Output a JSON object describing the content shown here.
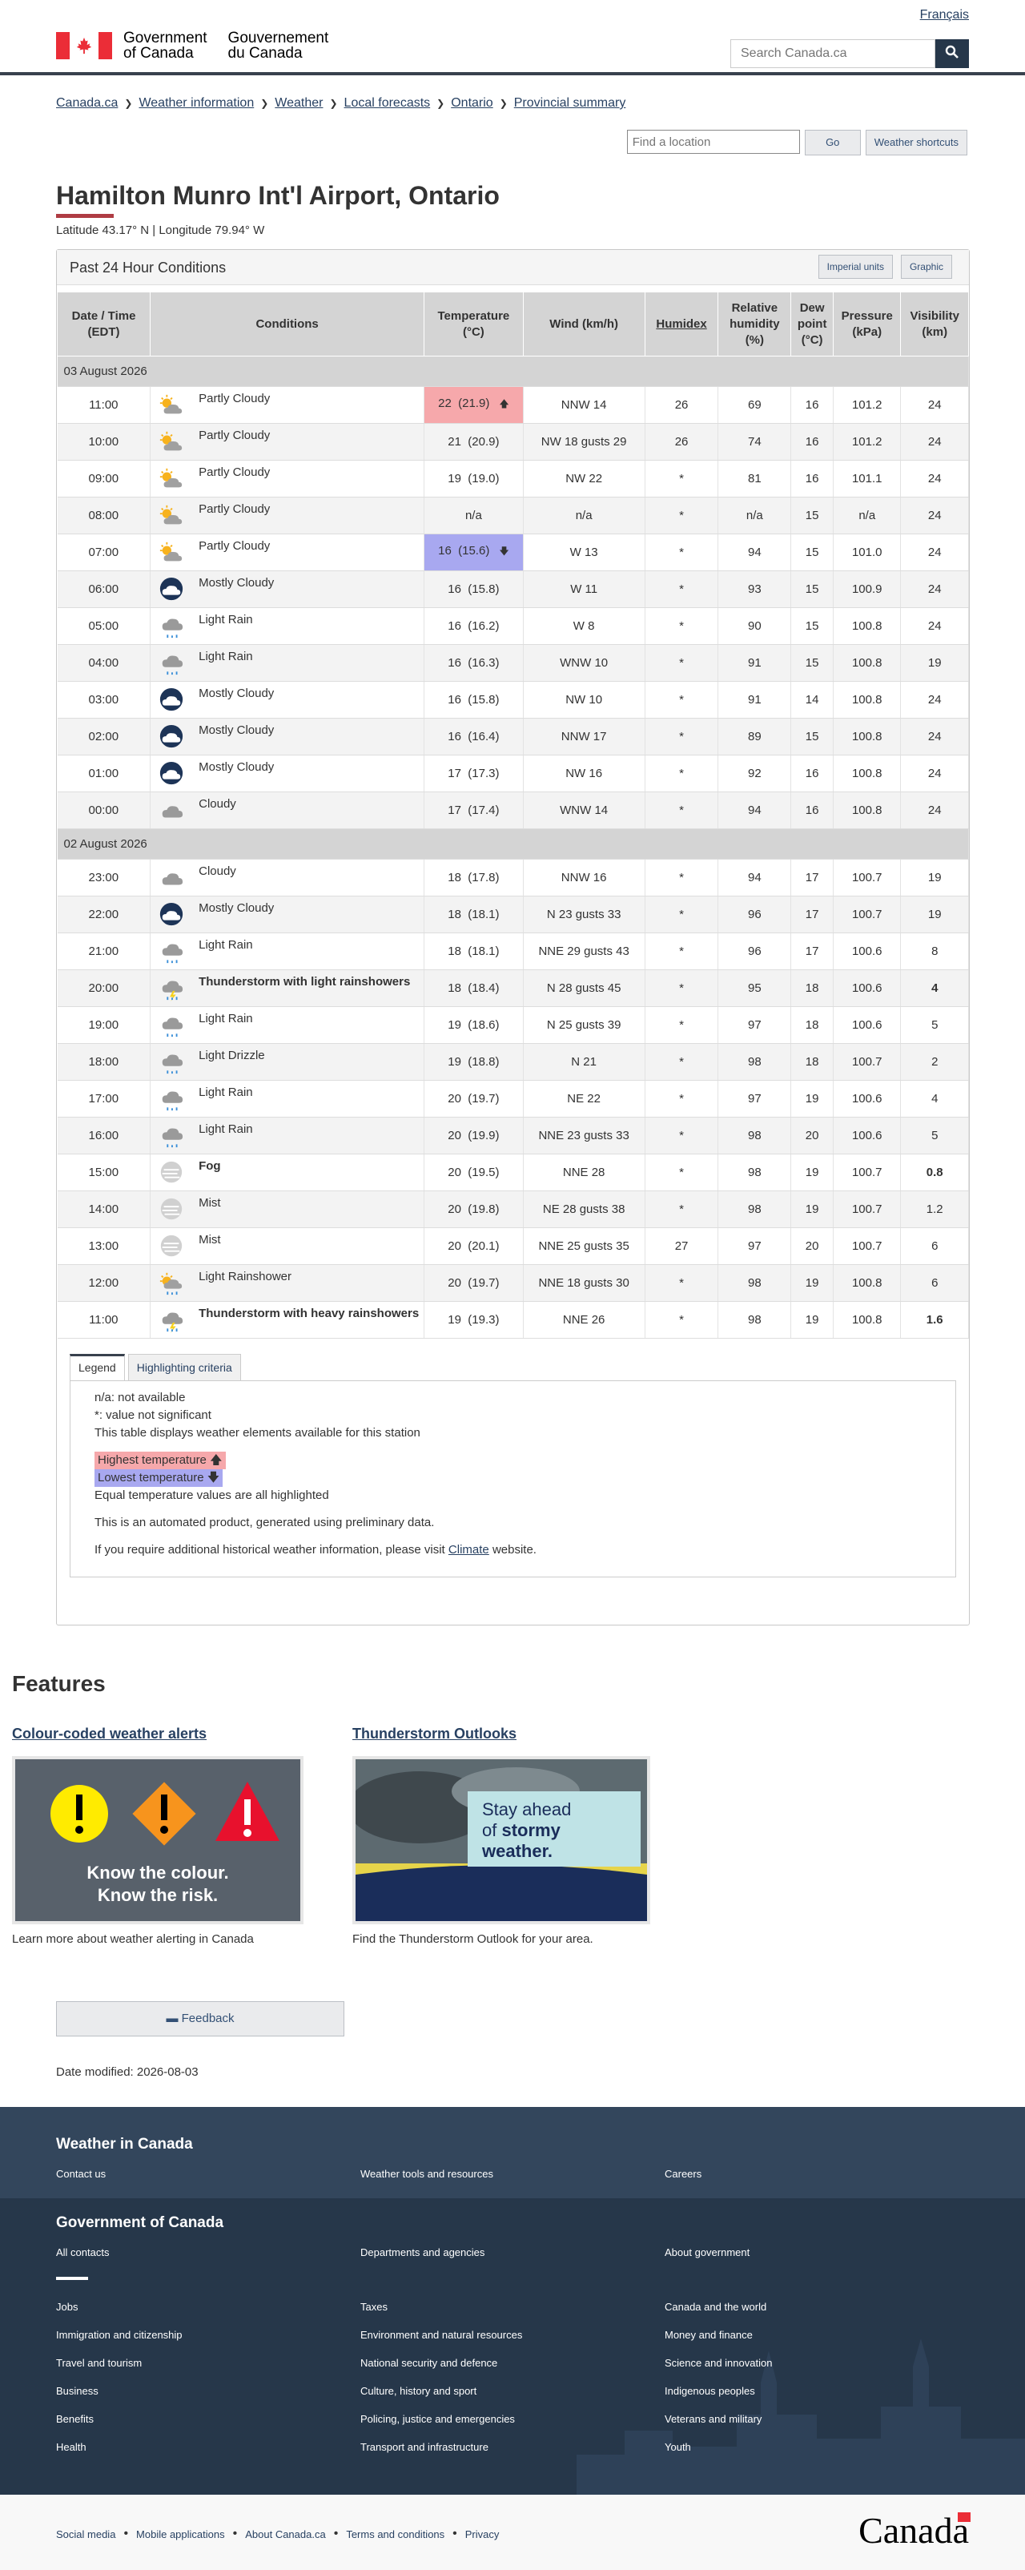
{
  "header": {
    "language_link": "Français",
    "signature_en": [
      "Government",
      "of Canada"
    ],
    "signature_fr": [
      "Gouvernement",
      "du Canada"
    ],
    "search_placeholder": "Search Canada.ca"
  },
  "breadcrumb": [
    "Canada.ca",
    "Weather information",
    "Weather",
    "Local forecasts",
    "Ontario",
    "Provincial summary"
  ],
  "location_search": {
    "placeholder": "Find a location",
    "go_label": "Go",
    "shortcuts_label": "Weather shortcuts"
  },
  "page": {
    "title": "Hamilton Munro Int'l Airport, Ontario",
    "latlon": "Latitude 43.17° N | Longitude 79.94° W"
  },
  "panel": {
    "title": "Past 24 Hour Conditions",
    "imperial_label": "Imperial units",
    "graphic_label": "Graphic",
    "columns": [
      "Date / Time (EDT)",
      "Conditions",
      "Temperature (°C)",
      "Wind (km/h)",
      "Humidex",
      "Relative humidity (%)",
      "Dew point (°C)",
      "Pressure (kPa)",
      "Visibility (km)"
    ],
    "date1": "03 August 2026",
    "date2": "02 August 2026",
    "rows_day1": [
      {
        "time": "11:00",
        "icon": "partly-cloudy",
        "cond": "Partly Cloudy",
        "temp": "22  (21.9)",
        "wind": "NNW 14",
        "humidex": "26",
        "rh": "69",
        "dew": "16",
        "pres": "101.2",
        "vis": "24",
        "flag": "hi"
      },
      {
        "time": "10:00",
        "icon": "partly-cloudy",
        "cond": "Partly Cloudy",
        "temp": "21  (20.9)",
        "wind": "NW 18 gusts 29",
        "humidex": "26",
        "rh": "74",
        "dew": "16",
        "pres": "101.2",
        "vis": "24"
      },
      {
        "time": "09:00",
        "icon": "partly-cloudy",
        "cond": "Partly Cloudy",
        "temp": "19  (19.0)",
        "wind": "NW 22",
        "humidex": "*",
        "rh": "81",
        "dew": "16",
        "pres": "101.1",
        "vis": "24"
      },
      {
        "time": "08:00",
        "icon": "partly-cloudy",
        "cond": "Partly Cloudy",
        "temp": "n/a",
        "wind": "n/a",
        "humidex": "*",
        "rh": "n/a",
        "dew": "15",
        "pres": "n/a",
        "vis": "24"
      },
      {
        "time": "07:00",
        "icon": "partly-cloudy",
        "cond": "Partly Cloudy",
        "temp": "16  (15.6)",
        "wind": "W 13",
        "humidex": "*",
        "rh": "94",
        "dew": "15",
        "pres": "101.0",
        "vis": "24",
        "flag": "lo"
      },
      {
        "time": "06:00",
        "icon": "mostly-cloudy",
        "cond": "Mostly Cloudy",
        "temp": "16  (15.8)",
        "wind": "W 11",
        "humidex": "*",
        "rh": "93",
        "dew": "15",
        "pres": "100.9",
        "vis": "24"
      },
      {
        "time": "05:00",
        "icon": "light-rain",
        "cond": "Light Rain",
        "temp": "16  (16.2)",
        "wind": "W 8",
        "humidex": "*",
        "rh": "90",
        "dew": "15",
        "pres": "100.8",
        "vis": "24"
      },
      {
        "time": "04:00",
        "icon": "light-rain",
        "cond": "Light Rain",
        "temp": "16  (16.3)",
        "wind": "WNW 10",
        "humidex": "*",
        "rh": "91",
        "dew": "15",
        "pres": "100.8",
        "vis": "19"
      },
      {
        "time": "03:00",
        "icon": "mostly-cloudy",
        "cond": "Mostly Cloudy",
        "temp": "16  (15.8)",
        "wind": "NW 10",
        "humidex": "*",
        "rh": "91",
        "dew": "14",
        "pres": "100.8",
        "vis": "24"
      },
      {
        "time": "02:00",
        "icon": "mostly-cloudy",
        "cond": "Mostly Cloudy",
        "temp": "16  (16.4)",
        "wind": "NNW 17",
        "humidex": "*",
        "rh": "89",
        "dew": "15",
        "pres": "100.8",
        "vis": "24"
      },
      {
        "time": "01:00",
        "icon": "mostly-cloudy",
        "cond": "Mostly Cloudy",
        "temp": "17  (17.3)",
        "wind": "NW 16",
        "humidex": "*",
        "rh": "92",
        "dew": "16",
        "pres": "100.8",
        "vis": "24"
      },
      {
        "time": "00:00",
        "icon": "cloudy",
        "cond": "Cloudy",
        "temp": "17  (17.4)",
        "wind": "WNW 14",
        "humidex": "*",
        "rh": "94",
        "dew": "16",
        "pres": "100.8",
        "vis": "24"
      }
    ],
    "rows_day2": [
      {
        "time": "23:00",
        "icon": "cloudy",
        "cond": "Cloudy",
        "temp": "18  (17.8)",
        "wind": "NNW 16",
        "humidex": "*",
        "rh": "94",
        "dew": "17",
        "pres": "100.7",
        "vis": "19"
      },
      {
        "time": "22:00",
        "icon": "mostly-cloudy",
        "cond": "Mostly Cloudy",
        "temp": "18  (18.1)",
        "wind": "N 23 gusts 33",
        "humidex": "*",
        "rh": "96",
        "dew": "17",
        "pres": "100.7",
        "vis": "19"
      },
      {
        "time": "21:00",
        "icon": "light-rain",
        "cond": "Light Rain",
        "temp": "18  (18.1)",
        "wind": "NNE 29 gusts 43",
        "humidex": "*",
        "rh": "96",
        "dew": "17",
        "pres": "100.6",
        "vis": "8"
      },
      {
        "time": "20:00",
        "icon": "thunderstorm",
        "cond": "Thunderstorm with light rainshowers",
        "temp": "18  (18.4)",
        "wind": "N 28 gusts 45",
        "humidex": "*",
        "rh": "95",
        "dew": "18",
        "pres": "100.6",
        "vis": "4",
        "bold": true
      },
      {
        "time": "19:00",
        "icon": "light-rain",
        "cond": "Light Rain",
        "temp": "19  (18.6)",
        "wind": "N 25 gusts 39",
        "humidex": "*",
        "rh": "97",
        "dew": "18",
        "pres": "100.6",
        "vis": "5"
      },
      {
        "time": "18:00",
        "icon": "light-rain",
        "cond": "Light Drizzle",
        "temp": "19  (18.8)",
        "wind": "N 21",
        "humidex": "*",
        "rh": "98",
        "dew": "18",
        "pres": "100.7",
        "vis": "2"
      },
      {
        "time": "17:00",
        "icon": "light-rain",
        "cond": "Light Rain",
        "temp": "20  (19.7)",
        "wind": "NE 22",
        "humidex": "*",
        "rh": "97",
        "dew": "19",
        "pres": "100.6",
        "vis": "4"
      },
      {
        "time": "16:00",
        "icon": "light-rain",
        "cond": "Light Rain",
        "temp": "20  (19.9)",
        "wind": "NNE 23 gusts 33",
        "humidex": "*",
        "rh": "98",
        "dew": "20",
        "pres": "100.6",
        "vis": "5"
      },
      {
        "time": "15:00",
        "icon": "fog",
        "cond": "Fog",
        "temp": "20  (19.5)",
        "wind": "NNE 28",
        "humidex": "*",
        "rh": "98",
        "dew": "19",
        "pres": "100.7",
        "vis": "0.8",
        "bold": true
      },
      {
        "time": "14:00",
        "icon": "fog",
        "cond": "Mist",
        "temp": "20  (19.8)",
        "wind": "NE 28 gusts 38",
        "humidex": "*",
        "rh": "98",
        "dew": "19",
        "pres": "100.7",
        "vis": "1.2"
      },
      {
        "time": "13:00",
        "icon": "fog",
        "cond": "Mist",
        "temp": "20  (20.1)",
        "wind": "NNE 25 gusts 35",
        "humidex": "27",
        "rh": "97",
        "dew": "20",
        "pres": "100.7",
        "vis": "6"
      },
      {
        "time": "12:00",
        "icon": "rainshower",
        "cond": "Light Rainshower",
        "temp": "20  (19.7)",
        "wind": "NNE 18 gusts 30",
        "humidex": "*",
        "rh": "98",
        "dew": "19",
        "pres": "100.8",
        "vis": "6"
      },
      {
        "time": "11:00",
        "icon": "thunderstorm",
        "cond": "Thunderstorm with heavy rainshowers",
        "temp": "19  (19.3)",
        "wind": "NNE 26",
        "humidex": "*",
        "rh": "98",
        "dew": "19",
        "pres": "100.8",
        "vis": "1.6",
        "bold": true
      }
    ]
  },
  "legend": {
    "tab_legend": "Legend",
    "tab_criteria": "Highlighting criteria",
    "na": "n/a: not available",
    "star": "*: value not significant",
    "elements": "This table displays weather elements available for this station",
    "highest": "Highest temperature",
    "lowest": "Lowest temperature",
    "equal": "Equal temperature values are all highlighted",
    "automated": "This is an automated product, generated using preliminary data.",
    "climate_pre": "If you require additional historical weather information, please visit",
    "climate_link": "Climate",
    "climate_post": "website."
  },
  "features": {
    "heading": "Features",
    "f1_title": "Colour-coded weather alerts",
    "f1_img_line1": "Know the colour.",
    "f1_img_line2": "Know the risk.",
    "f1_desc": "Learn more about weather alerting in Canada",
    "f2_title": "Thunderstorm Outlooks",
    "f2_img_line1": "Stay ahead",
    "f2_img_line2": "of",
    "f2_img_line2b": "stormy",
    "f2_img_line3": "weather.",
    "f2_desc": "Find the Thunderstorm Outlook for your area."
  },
  "feedback_label": "Feedback",
  "date_modified": "Date modified: 2026-08-03",
  "footer": {
    "weather_heading": "Weather in Canada",
    "weather_links": [
      "Contact us",
      "Weather tools and resources",
      "Careers"
    ],
    "gov_heading": "Government of Canada",
    "gov_links_top": [
      "All contacts",
      "Departments and agencies",
      "About government"
    ],
    "gov_links": [
      [
        "Jobs",
        "Taxes",
        "Canada and the world"
      ],
      [
        "Immigration and citizenship",
        "Environment and natural resources",
        "Money and finance"
      ],
      [
        "Travel and tourism",
        "National security and defence",
        "Science and innovation"
      ],
      [
        "Business",
        "Culture, history and sport",
        "Indigenous peoples"
      ],
      [
        "Benefits",
        "Policing, justice and emergencies",
        "Veterans and military"
      ],
      [
        "Health",
        "Transport and infrastructure",
        "Youth"
      ]
    ],
    "bottom_links": [
      "Social media",
      "Mobile applications",
      "About Canada.ca",
      "Terms and conditions",
      "Privacy"
    ],
    "wordmark": "Canada"
  }
}
